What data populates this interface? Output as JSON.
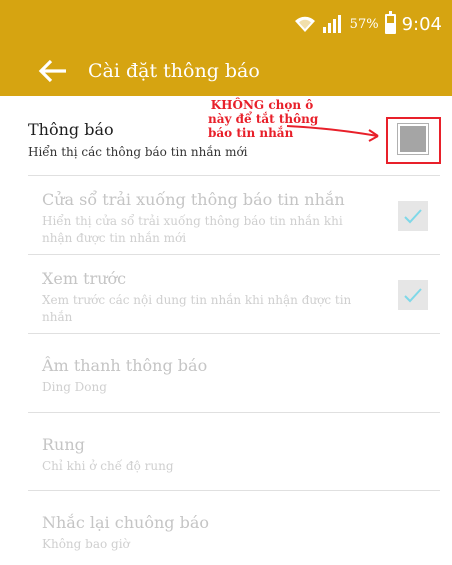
{
  "status_bar": {
    "battery_percent": "57%",
    "battery_level": 0.57,
    "time": "9:04",
    "icons": [
      "wifi-icon",
      "signal-icon",
      "battery-icon"
    ]
  },
  "app_bar": {
    "title": "Cài đặt thông báo",
    "back_icon": "arrow-left-icon"
  },
  "annotation": {
    "lines": [
      "KHÔNG chọn ô",
      "này để tắt thông",
      "báo tin nhắn"
    ],
    "color": "#e8202a"
  },
  "settings": [
    {
      "title": "Thông báo",
      "summary": "Hiển thị các thông báo tin nhắn mới",
      "checked": false,
      "enabled": true
    },
    {
      "title": "Cửa sổ trải xuống thông báo tin nhắn",
      "summary": "Hiển thị cửa sổ trải xuống thông báo tin nhắn khi nhận được tin nhắn mới",
      "checked": true,
      "enabled": false
    },
    {
      "title": "Xem trước",
      "summary": "Xem trước các nội dung tin nhắn khi nhận được tin nhắn",
      "checked": true,
      "enabled": false
    },
    {
      "title": "Âm thanh thông báo",
      "summary": "Ding Dong",
      "enabled": false
    },
    {
      "title": "Rung",
      "summary": "Chỉ khi ở chế độ rung",
      "enabled": false
    },
    {
      "title": "Nhắc lại chuông báo",
      "summary": "Không bao giờ",
      "enabled": false
    }
  ],
  "colors": {
    "accent": "#d6a411",
    "checkmark": "#7fd8e8",
    "annotation": "#e8202a"
  }
}
